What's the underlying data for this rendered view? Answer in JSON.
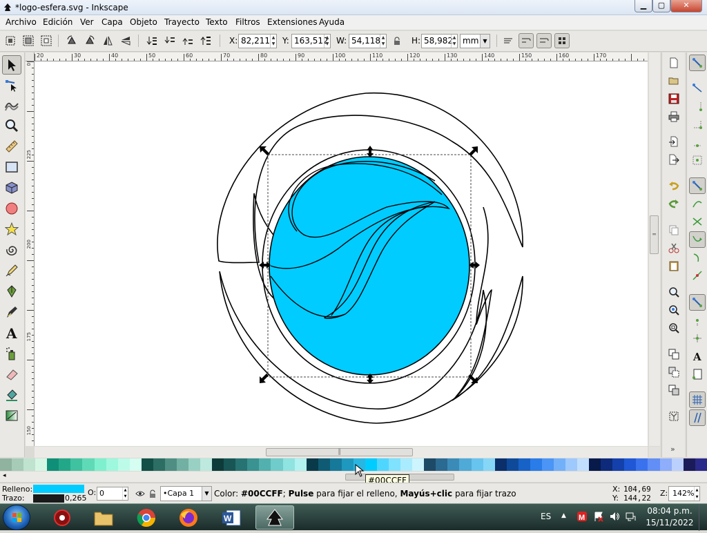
{
  "window": {
    "title": "*logo-esfera.svg - Inkscape",
    "min_glyph": "▁",
    "max_glyph": "▢",
    "close_glyph": "✕"
  },
  "menu": {
    "items": [
      "Archivo",
      "Edición",
      "Ver",
      "Capa",
      "Objeto",
      "Trayecto",
      "Texto",
      "Filtros",
      "Extensiones",
      "Ayuda"
    ]
  },
  "toolbar": {
    "x_label": "X:",
    "x_value": "82,211",
    "y_label": "Y:",
    "y_value": "163,512",
    "w_label": "W:",
    "w_value": "54,118",
    "h_label": "H:",
    "h_value": "58,982",
    "units": "mm"
  },
  "ruler": {
    "h_labels": [
      "20",
      "30",
      "40",
      "50",
      "60",
      "70",
      "80",
      "90",
      "100",
      "110",
      "120",
      "130",
      "140",
      "150",
      "160",
      "170"
    ],
    "v_labels": [
      "0",
      "225",
      "200",
      "175",
      "150"
    ]
  },
  "palette": {
    "colors": [
      "#8fb39f",
      "#a6cbb7",
      "#bfe3cf",
      "#d6f6e4",
      "#0f8f77",
      "#22a889",
      "#3fc29f",
      "#5fdab7",
      "#7ff0cd",
      "#9ef8de",
      "#bdfbe9",
      "#d5fdf1",
      "#114f47",
      "#2d6e64",
      "#4f8f83",
      "#73b0a4",
      "#99d0c4",
      "#bde9df",
      "#0d3b3a",
      "#185656",
      "#277373",
      "#3a9291",
      "#52b0ae",
      "#6fccca",
      "#8fe3e1",
      "#b2f2f0",
      "#093a4a",
      "#0f5b73",
      "#16799a",
      "#1f98bf",
      "#29b6e1",
      "#00ccff",
      "#4fd6ff",
      "#7fe2ff",
      "#aaecff",
      "#cdf5ff",
      "#1d4a66",
      "#2b6a91",
      "#3b8bb8",
      "#4faad7",
      "#67c4ef",
      "#86d6f8",
      "#0a2f6a",
      "#0f4a9a",
      "#1762c7",
      "#2a7ce8",
      "#4a95f5",
      "#73b0fa",
      "#9dc9fd",
      "#c1defe",
      "#071a4a",
      "#0d2b7a",
      "#1440ab",
      "#1f57d6",
      "#3a72ee",
      "#628ff6",
      "#8eaefb",
      "#bcd0fd",
      "#1b1b5a",
      "#2a2a8a"
    ],
    "tooltip": "#00CCFF"
  },
  "status": {
    "fill_label": "Relleno:",
    "stroke_label": "Trazo:",
    "stroke_width": "0,265",
    "fill_color": "#00ccff",
    "stroke_color": "#1a1a1a",
    "opacity_label": "O:",
    "opacity_value": "0",
    "layer": "•Capa 1",
    "msg_prefix": "Color: ",
    "msg_color": "#00CCFF",
    "msg_sep": "; ",
    "msg_pulse": "Pulse",
    "msg_mid": " para fijar el relleno, ",
    "msg_shift": "Mayús+clic",
    "msg_end": " para fijar trazo",
    "x_label": "X:",
    "x_value": "104,69",
    "y_label": "Y:",
    "y_value": "144,22",
    "zoom_label": "Z:",
    "zoom_value": "142%"
  },
  "taskbar": {
    "lang": "ES",
    "time": "08:04 p.m.",
    "date": "15/11/2022"
  },
  "theme": {
    "accent": "#00ccff",
    "canvas": "#ffffff",
    "chrome": "#e9e8e4"
  }
}
